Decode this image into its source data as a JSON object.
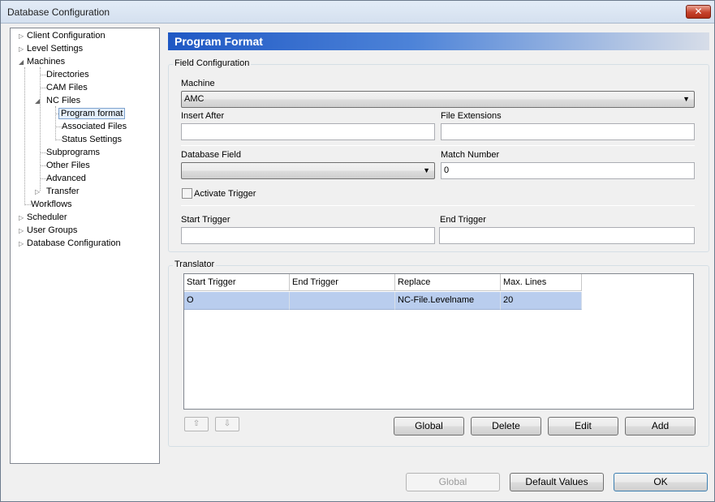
{
  "window": {
    "title": "Database Configuration",
    "close_label": "✕"
  },
  "tree": {
    "items": [
      {
        "label": "Client Configuration",
        "expander": "▷"
      },
      {
        "label": "Level Settings",
        "expander": "▷"
      },
      {
        "label": "Machines",
        "expander": "◢"
      },
      {
        "label": "Directories"
      },
      {
        "label": "CAM Files"
      },
      {
        "label": "NC Files",
        "expander": "◢"
      },
      {
        "label": "Program format",
        "selected": true
      },
      {
        "label": "Associated Files"
      },
      {
        "label": "Status Settings"
      },
      {
        "label": "Subprograms"
      },
      {
        "label": "Other Files"
      },
      {
        "label": "Advanced"
      },
      {
        "label": "Transfer",
        "expander": "▷"
      },
      {
        "label": "Workflows"
      },
      {
        "label": "Scheduler",
        "expander": "▷"
      },
      {
        "label": "User Groups",
        "expander": "▷"
      },
      {
        "label": "Database Configuration",
        "expander": "▷"
      }
    ]
  },
  "header": {
    "title": "Program Format"
  },
  "field_config": {
    "title": "Field Configuration",
    "machine_label": "Machine",
    "machine_value": "AMC",
    "insert_after_label": "Insert After",
    "insert_after_value": "",
    "file_extensions_label": "File Extensions",
    "file_extensions_value": "",
    "database_field_label": "Database Field",
    "database_field_value": "",
    "match_number_label": "Match Number",
    "match_number_value": "0",
    "activate_trigger_label": "Activate Trigger",
    "activate_trigger_checked": false,
    "start_trigger_label": "Start Trigger",
    "start_trigger_value": "",
    "end_trigger_label": "End Trigger",
    "end_trigger_value": ""
  },
  "translator": {
    "title": "Translator",
    "columns": [
      "Start Trigger",
      "End Trigger",
      "Replace",
      "Max. Lines"
    ],
    "rows": [
      [
        "O",
        "",
        "NC-File.Levelname",
        "20"
      ]
    ],
    "up_icon": "⇧",
    "down_icon": "⇩",
    "buttons": {
      "global": "Global",
      "delete": "Delete",
      "edit": "Edit",
      "add": "Add"
    }
  },
  "footer": {
    "global": "Global",
    "default_values": "Default Values",
    "ok": "OK"
  }
}
